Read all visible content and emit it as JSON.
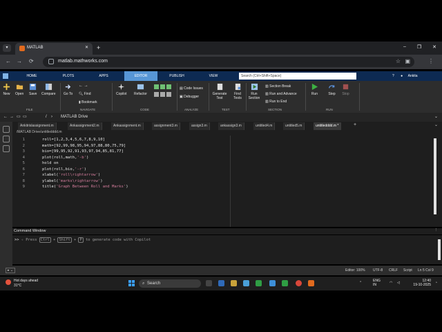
{
  "browser": {
    "tab_title": "MATLAB",
    "tab_close": "✕",
    "new_tab": "+",
    "url": "matlab.mathworks.com",
    "back": "←",
    "forward": "→",
    "reload": "⟳",
    "star": "☆",
    "menu": "⋮",
    "minimize": "–",
    "restore": "❐",
    "close": "✕"
  },
  "ribbon_tabs": [
    "HOME",
    "PLOTS",
    "APPS",
    "EDITOR",
    "PUBLISH",
    "VIEW"
  ],
  "search_placeholder": "Search (Ctrl+Shift+Space)",
  "user_name": "Ankita",
  "toolstrip": {
    "file": {
      "new": "New",
      "open": "Open",
      "save": "Save",
      "compare": "Compare",
      "group": "FILE"
    },
    "navigate": {
      "goto": "Go To",
      "find": "Find",
      "bookmark": "Bookmark",
      "group": "NAVIGATE"
    },
    "code": {
      "copilot": "Copilot",
      "refactor": "Refactor",
      "group": "CODE"
    },
    "analyze": {
      "code_issues": "Code Issues",
      "debugger": "Debugger",
      "group": "ANALYZE"
    },
    "test": {
      "generate_test": "Generate Test",
      "find_tests": "Find Tests",
      "group": "TEST"
    },
    "section": {
      "run_section": "Run Section",
      "section_break": "Section Break",
      "run_and_advance": "Run and Advance",
      "run_to_end": "Run to End",
      "group": "SECTION"
    },
    "run": {
      "run": "Run",
      "step": "Step",
      "stop": "Stop",
      "group": "RUN"
    }
  },
  "path": {
    "root": "/",
    "drive": "MATLAB Drive"
  },
  "editor_tabs": [
    "Ankitrislassignment.m",
    "Ankassignment2.m",
    "Ankassignment.m",
    "assignment3.m",
    "assign3.m",
    "ankassign3.m",
    "untitled4.m",
    "untitled5.m",
    "untitledddd.m *"
  ],
  "file_path": "/MATLAB Drive/untitledddd.m",
  "code_lines": [
    {
      "n": "1",
      "code": "roll=[1,2,3,4,5,6,7,8,9,10]",
      "str": ""
    },
    {
      "n": "2",
      "code": "math=[92,99,98,95,94,97,88,80,75,79]",
      "str": ""
    },
    {
      "n": "3",
      "code": "bio=[99,95,92,91,93,97,94,85,81,77]",
      "str": ""
    },
    {
      "n": "4",
      "code": "plot(roll,math,",
      "str": "'-b'",
      "tail": ")"
    },
    {
      "n": "5",
      "code": "hold on",
      "str": ""
    },
    {
      "n": "6",
      "code": "plot(roll,bio,",
      "str": "'-r'",
      "tail": ")"
    },
    {
      "n": "7",
      "code": "xlabel(",
      "str": "'roll\\rightarrow'",
      "tail": ")"
    },
    {
      "n": "8",
      "code": "ylabel(",
      "str": "'marks\\rightarrow'",
      "tail": ")"
    },
    {
      "n": "9",
      "code": "title(",
      "str": "'Graph Between Roll and Marks'",
      "tail": ")"
    }
  ],
  "command_window": {
    "title": "Command Window",
    "prompt": ">>",
    "hint_press": "Press",
    "key_ctrl": "Ctrl",
    "plus": "+",
    "key_shift": "Shift",
    "key_p": "P",
    "hint_rest": "to generate code with Copilot"
  },
  "status": {
    "zoom": "Editor: 100%",
    "encoding": "UTF-8",
    "eol": "CRLF",
    "type": "Script",
    "position": "Ln 5  Col 9"
  },
  "taskbar": {
    "weather": "Hot days ahead",
    "temp": "31°C",
    "search": "Search",
    "lang1": "ENG",
    "lang2": "IN",
    "time": "12:40",
    "date": "19-10-2025"
  }
}
